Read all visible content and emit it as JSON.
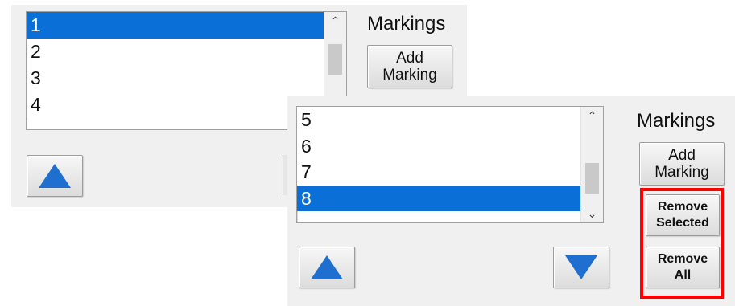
{
  "panel_before": {
    "heading": "Markings",
    "add_button": "Add\nMarking",
    "list_items": [
      "1",
      "2",
      "3",
      "4"
    ],
    "selected_item": "1"
  },
  "panel_after": {
    "heading": "Markings",
    "add_button": "Add\nMarking",
    "remove_selected_button": "Remove\nSelected",
    "remove_all_button": "Remove\nAll",
    "list_items": [
      "5",
      "6",
      "7",
      "8"
    ],
    "selected_item": "8"
  },
  "scroll_icons": {
    "up": "chevron-up-icon",
    "down": "chevron-down-icon"
  },
  "colors": {
    "selection": "#0a6fd6",
    "arrow": "#1e6fd0",
    "highlight": "#ff0000"
  }
}
